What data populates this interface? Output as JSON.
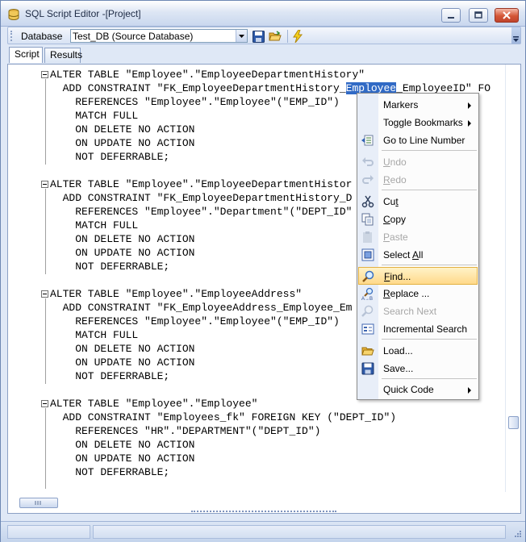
{
  "window": {
    "title": "SQL Script Editor -[Project]"
  },
  "toolbar": {
    "database_label": "Database",
    "database_value": "Test_DB (Source Database)"
  },
  "tabs": [
    {
      "label": "Script"
    },
    {
      "label": "Results"
    }
  ],
  "editor": {
    "blocks": [
      {
        "header": "ALTER TABLE \"Employee\".\"EmployeeDepartmentHistory\"",
        "lines": [
          {
            "pre": "  ADD CONSTRAINT \"FK_EmployeeDepartmentHistory_",
            "sel": "Employee",
            "post": "_EmployeeID\" FO"
          },
          {
            "text": "    REFERENCES \"Employee\".\"Employee\"(\"EMP_ID\")"
          },
          {
            "text": "    MATCH FULL"
          },
          {
            "text": "    ON DELETE NO ACTION"
          },
          {
            "text": "    ON UPDATE NO ACTION"
          },
          {
            "text": "    NOT DEFERRABLE;"
          }
        ]
      },
      {
        "header": "ALTER TABLE \"Employee\".\"EmployeeDepartmentHistor",
        "lines": [
          {
            "text": "  ADD CONSTRAINT \"FK_EmployeeDepartmentHistory_D             entID"
          },
          {
            "text": "    REFERENCES \"Employee\".\"Department\"(\"DEPT_ID\""
          },
          {
            "text": "    MATCH FULL"
          },
          {
            "text": "    ON DELETE NO ACTION"
          },
          {
            "text": "    ON UPDATE NO ACTION"
          },
          {
            "text": "    NOT DEFERRABLE;"
          }
        ]
      },
      {
        "header": "ALTER TABLE \"Employee\".\"EmployeeAddress\"",
        "lines": [
          {
            "text": "  ADD CONSTRAINT \"FK_EmployeeAddress_Employee_Em              KEY"
          },
          {
            "text": "    REFERENCES \"Employee\".\"Employee\"(\"EMP_ID\")"
          },
          {
            "text": "    MATCH FULL"
          },
          {
            "text": "    ON DELETE NO ACTION"
          },
          {
            "text": "    ON UPDATE NO ACTION"
          },
          {
            "text": "    NOT DEFERRABLE;"
          }
        ]
      },
      {
        "header": "ALTER TABLE \"Employee\".\"Employee\"",
        "lines": [
          {
            "text": "  ADD CONSTRAINT \"Employees_fk\" FOREIGN KEY (\"DEPT_ID\")"
          },
          {
            "text": "    REFERENCES \"HR\".\"DEPARTMENT\"(\"DEPT_ID\")"
          },
          {
            "text": "    ON DELETE NO ACTION"
          },
          {
            "text": "    ON UPDATE NO ACTION"
          },
          {
            "text": "    NOT DEFERRABLE;"
          }
        ]
      }
    ]
  },
  "context_menu": {
    "items": [
      {
        "label": "Markers",
        "icon": "none",
        "submenu": true,
        "enabled": true
      },
      {
        "label": "Toggle Bookmarks",
        "icon": "none",
        "submenu": true,
        "enabled": true
      },
      {
        "label": "Go to Line Number",
        "icon": "goto-line-icon",
        "submenu": false,
        "enabled": true
      },
      {
        "label": "Undo",
        "icon": "undo-icon",
        "submenu": false,
        "enabled": false
      },
      {
        "label": "Redo",
        "icon": "redo-icon",
        "submenu": false,
        "enabled": false
      },
      {
        "label": "Cut",
        "icon": "cut-icon",
        "submenu": false,
        "enabled": true
      },
      {
        "label": "Copy",
        "icon": "copy-icon",
        "submenu": false,
        "enabled": true
      },
      {
        "label": "Paste",
        "icon": "paste-icon",
        "submenu": false,
        "enabled": false
      },
      {
        "label": "Select All",
        "icon": "select-all-icon",
        "submenu": false,
        "enabled": true
      },
      {
        "label": "Find...",
        "icon": "find-icon",
        "submenu": false,
        "enabled": true,
        "highlighted": true
      },
      {
        "label": "Replace ...",
        "icon": "replace-icon",
        "submenu": false,
        "enabled": true
      },
      {
        "label": "Search Next",
        "icon": "search-next-icon",
        "submenu": false,
        "enabled": false
      },
      {
        "label": "Incremental Search",
        "icon": "incremental-search-icon",
        "submenu": false,
        "enabled": true
      },
      {
        "label": "Load...",
        "icon": "folder-open-icon",
        "submenu": false,
        "enabled": true
      },
      {
        "label": "Save...",
        "icon": "save-icon",
        "submenu": false,
        "enabled": true
      },
      {
        "label": "Quick Code",
        "icon": "none",
        "submenu": true,
        "enabled": true
      }
    ]
  },
  "colors": {
    "selection": "#316ac5",
    "menu_highlight": "#ffd98a",
    "frame": "#dfe8f6"
  }
}
